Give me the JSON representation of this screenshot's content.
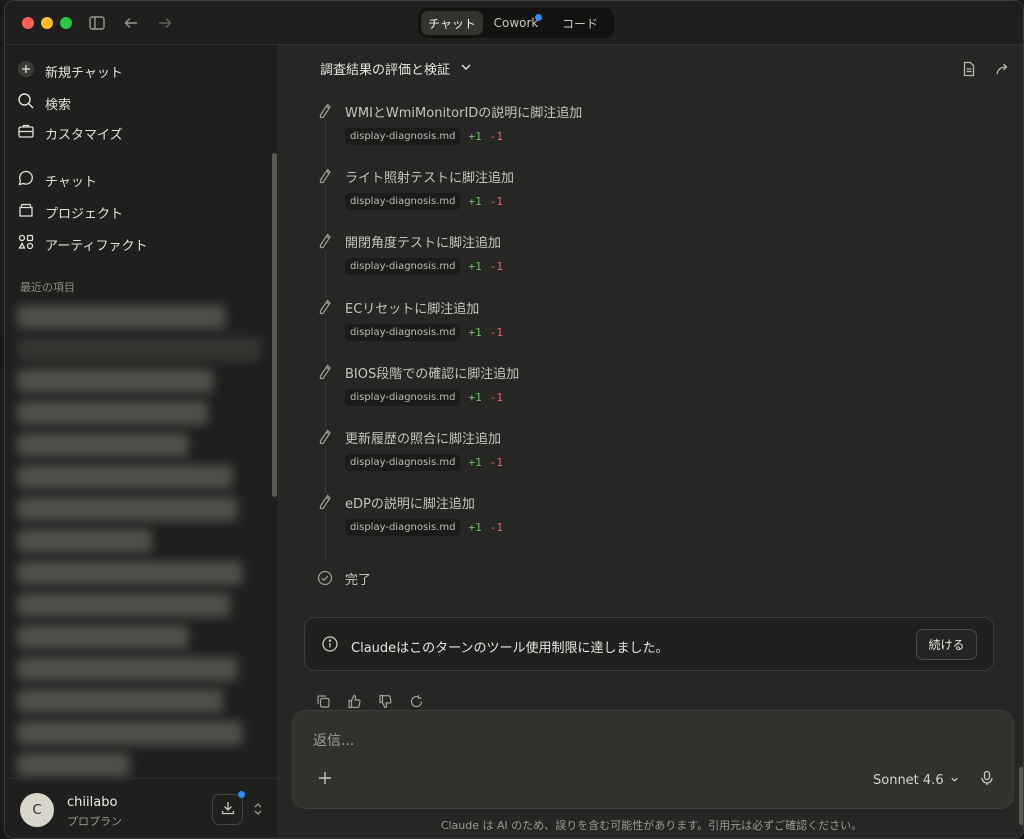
{
  "titlebar": {
    "modes": [
      {
        "label": "チャット",
        "active": true
      },
      {
        "label": "Cowork",
        "active": false,
        "badge": true
      },
      {
        "label": "コード",
        "active": false
      }
    ]
  },
  "sidebar": {
    "items": [
      {
        "label": "新規チャット",
        "icon": "plus-circle-icon"
      },
      {
        "label": "検索",
        "icon": "search-icon"
      },
      {
        "label": "カスタマイズ",
        "icon": "briefcase-icon"
      },
      {
        "label": "チャット",
        "icon": "chat-bubble-icon"
      },
      {
        "label": "プロジェクト",
        "icon": "folder-icon"
      },
      {
        "label": "アーティファクト",
        "icon": "artifacts-icon"
      }
    ],
    "recent_label": "最近の項目",
    "user": {
      "initial": "C",
      "name": "chiilabo",
      "plan": "プロプラン"
    }
  },
  "header": {
    "title": "調査結果の評価と検証"
  },
  "steps": [
    {
      "title": "WMIとWmiMonitorIDの説明に脚注追加",
      "file": "display-diagnosis.md",
      "added": "+1",
      "removed": "-1"
    },
    {
      "title": "ライト照射テストに脚注追加",
      "file": "display-diagnosis.md",
      "added": "+1",
      "removed": "-1"
    },
    {
      "title": "開閉角度テストに脚注追加",
      "file": "display-diagnosis.md",
      "added": "+1",
      "removed": "-1"
    },
    {
      "title": "ECリセットに脚注追加",
      "file": "display-diagnosis.md",
      "added": "+1",
      "removed": "-1"
    },
    {
      "title": "BIOS段階での確認に脚注追加",
      "file": "display-diagnosis.md",
      "added": "+1",
      "removed": "-1"
    },
    {
      "title": "更新履歴の照合に脚注追加",
      "file": "display-diagnosis.md",
      "added": "+1",
      "removed": "-1"
    },
    {
      "title": "eDPの説明に脚注追加",
      "file": "display-diagnosis.md",
      "added": "+1",
      "removed": "-1"
    }
  ],
  "done_label": "完了",
  "notice": {
    "text": "Claudeはこのターンのツール使用制限に達しました。",
    "button": "続ける"
  },
  "composer": {
    "placeholder": "返信...",
    "model": "Sonnet 4.6"
  },
  "disclaimer": "Claude は AI のため、誤りを含む可能性があります。引用元は必ずご確認ください。",
  "colors": {
    "added": "#6fbf5e",
    "removed": "#e66a6a",
    "accent": "#2f8cf0"
  }
}
